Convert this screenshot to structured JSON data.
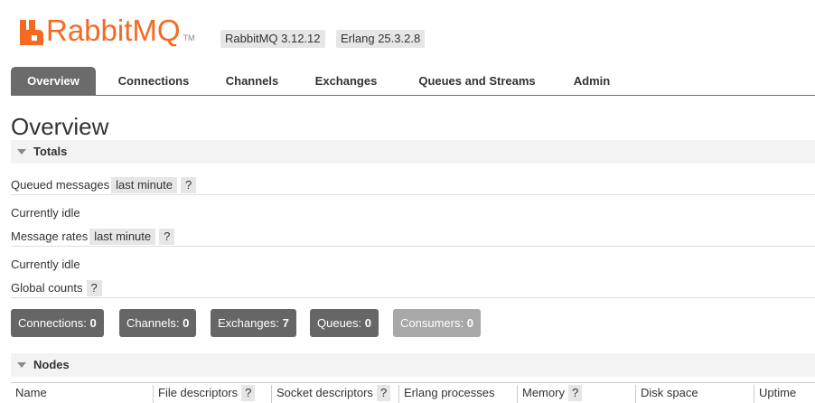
{
  "header": {
    "logo_text": "RabbitMQ",
    "logo_tm": "TM",
    "version_badge": "RabbitMQ 3.12.12",
    "erlang_badge": "Erlang 25.3.2.8",
    "brand_color": "#f56a23"
  },
  "tabs": [
    {
      "label": "Overview",
      "active": true
    },
    {
      "label": "Connections",
      "active": false
    },
    {
      "label": "Channels",
      "active": false
    },
    {
      "label": "Exchanges",
      "active": false
    },
    {
      "label": "Queues and Streams",
      "active": false
    },
    {
      "label": "Admin",
      "active": false
    }
  ],
  "page_title": "Overview",
  "totals": {
    "header": "Totals",
    "queued_messages_label": "Queued messages",
    "queued_messages_range": "last minute",
    "help": "?",
    "queued_status": "Currently idle",
    "message_rates_label": "Message rates",
    "message_rates_range": "last minute",
    "rates_status": "Currently idle",
    "global_counts_label": "Global counts"
  },
  "counts": [
    {
      "label": "Connections:",
      "value": "0"
    },
    {
      "label": "Channels:",
      "value": "0"
    },
    {
      "label": "Exchanges:",
      "value": "7"
    },
    {
      "label": "Queues:",
      "value": "0"
    },
    {
      "label": "Consumers:",
      "value": "0"
    }
  ],
  "nodes": {
    "header": "Nodes",
    "columns": [
      {
        "label": "Name",
        "help": ""
      },
      {
        "label": "File descriptors",
        "help": "?"
      },
      {
        "label": "Socket descriptors",
        "help": "?"
      },
      {
        "label": "Erlang processes",
        "help": ""
      },
      {
        "label": "Memory",
        "help": "?"
      },
      {
        "label": "Disk space",
        "help": ""
      },
      {
        "label": "Uptime",
        "help": ""
      }
    ]
  }
}
